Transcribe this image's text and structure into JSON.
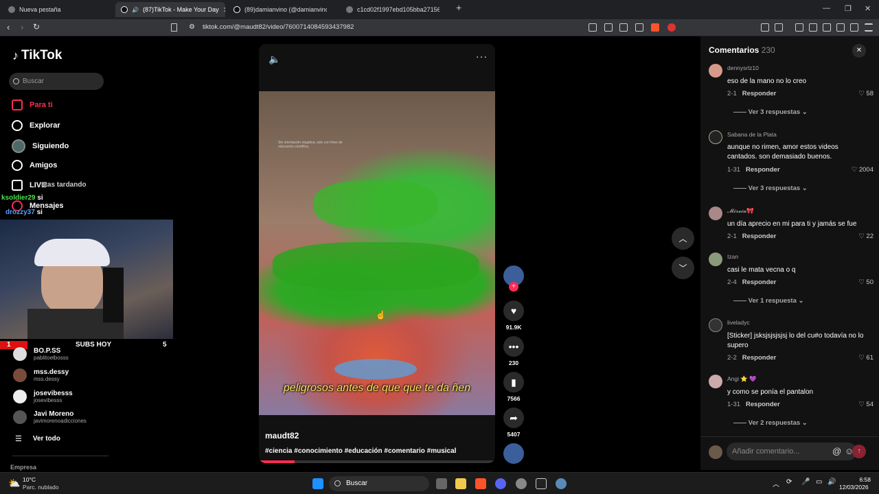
{
  "browser": {
    "tabs": [
      {
        "label": "Nueva pestaña"
      },
      {
        "label": "(87)TikTok - Make Your Day"
      },
      {
        "label": "(89)damianvino (@damianvino) | TikT"
      },
      {
        "label": "c1cd02f1997ebd105bba27156ef782c"
      }
    ],
    "url": "tiktok.com/@maudt82/video/7600714084593437982"
  },
  "sidebar": {
    "logo": "TikTok",
    "search_placeholder": "Buscar",
    "menu": [
      "Para ti",
      "Explorar",
      "Siguiendo",
      "Amigos",
      "LIVE",
      "Mensajes"
    ],
    "following": [
      {
        "name": "BO.P.SS",
        "user": "pablitoelbosss"
      },
      {
        "name": "mss.dessy",
        "user": "mss.dessy"
      },
      {
        "name": "josevibesss",
        "user": "josevibesss"
      },
      {
        "name": "Javi Moreno",
        "user": "javimorenoadicciones"
      }
    ],
    "see_all": "Ver todo",
    "footer": "Empresa"
  },
  "stream": {
    "chat": [
      {
        "user": "",
        "text": "stas tardando"
      },
      {
        "user": "ksoldier29",
        "text": "si"
      },
      {
        "user": "drozzy37",
        "text": "si"
      }
    ],
    "subs_rank": "1",
    "subs_label": "SUBS HOY",
    "subs_count": "5"
  },
  "video": {
    "caption": "peligrosos antes de que que te da ñen",
    "small_text": "Sin orientación negativa, solo con fines de educación científica.",
    "author": "maudt82",
    "hashtags": "#ciencia #conocimiento #educación #comentario #musical",
    "progress": 0.15
  },
  "actions": {
    "likes": "91.9K",
    "comments": "230",
    "saves": "7566",
    "shares": "5407"
  },
  "comments": {
    "title": "Comentarios",
    "count": "230",
    "input_placeholder": "Añadir comentario...",
    "items": [
      {
        "user": "dennysrlz10",
        "text": "eso de la mano no lo creo",
        "date": "2-1",
        "reply": "Responder",
        "likes": "58",
        "more": "Ver 3 respuestas"
      },
      {
        "user": "Sabana de la Plata",
        "text": "aunque no rimen, amor estos videos cantados. son demasiado buenos.",
        "date": "1-31",
        "reply": "Responder",
        "likes": "2004",
        "more": "Ver 3 respuestas"
      },
      {
        "user": "𝓜𝓲𝓻𝓮𝓲𝓪🎀",
        "text": "un día aprecio en mi para ti y jamás se fue",
        "date": "2-1",
        "reply": "Responder",
        "likes": "22",
        "more": ""
      },
      {
        "user": "Izan",
        "text": "casi le mata vecna o q",
        "date": "2-4",
        "reply": "Responder",
        "likes": "50",
        "more": "Ver 1 respuesta"
      },
      {
        "user": "liveladyc",
        "text": "[Sticker] jsksjsjsjsjsj lo del cu#o todavía no lo supero",
        "date": "2-2",
        "reply": "Responder",
        "likes": "61",
        "more": ""
      },
      {
        "user": "Angi ⭐ 💜",
        "text": "y como se ponía el pantalon",
        "date": "1-31",
        "reply": "Responder",
        "likes": "54",
        "more": "Ver 2 respuestas"
      }
    ]
  },
  "taskbar": {
    "weather_temp": "10°C",
    "weather_desc": "Parc. nublado",
    "search": "Buscar",
    "time": "6:58",
    "date": "12/03/2026"
  }
}
